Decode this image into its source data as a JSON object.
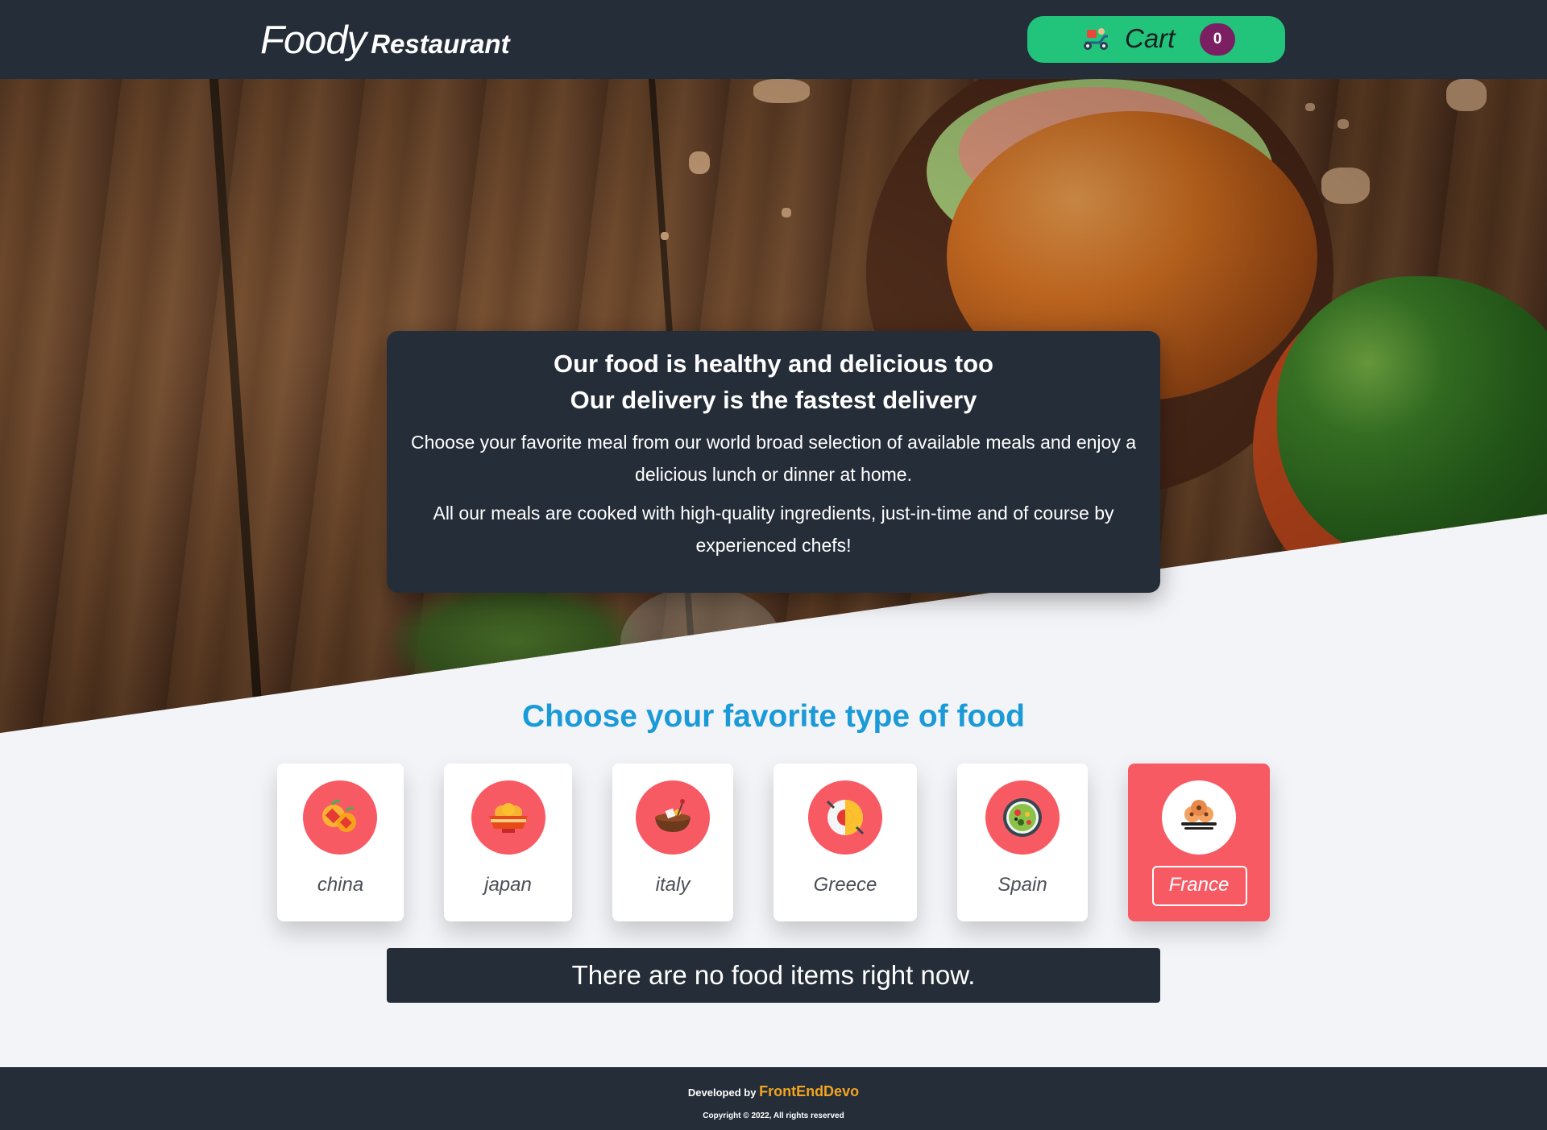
{
  "header": {
    "logo_main": "Foody",
    "logo_sub": "Restaurant",
    "cart_label": "Cart",
    "cart_count": "0",
    "cart_icon": "scooter-delivery-icon"
  },
  "hero": {
    "title_line1": "Our food is healthy and delicious too",
    "title_line2": "Our delivery is the fastest delivery",
    "paragraph1": "Choose your favorite meal from our world broad selection of available meals and enjoy a delicious lunch or dinner at home.",
    "paragraph2": "All our meals are cooked with high-quality ingredients, just-in-time and of course by experienced chefs!"
  },
  "section": {
    "title": "Choose your favorite type of food"
  },
  "food_types": [
    {
      "label": "china",
      "icon": "chinese-oranges-icon",
      "active": false
    },
    {
      "label": "japan",
      "icon": "japanese-bowl-icon",
      "active": false
    },
    {
      "label": "italy",
      "icon": "italian-pot-icon",
      "active": false
    },
    {
      "label": "Greece",
      "icon": "greek-pan-icon",
      "active": false
    },
    {
      "label": "Spain",
      "icon": "spanish-paella-icon",
      "active": false
    },
    {
      "label": "France",
      "icon": "french-pastry-icon",
      "active": true
    }
  ],
  "empty_message": "There are no food items right now.",
  "footer": {
    "developed_by": "Developed by",
    "developer": "FrontEndDevo",
    "copyright": "Copyright © 2022, All rights reserved"
  },
  "colors": {
    "header_bg": "#252d39",
    "cart_green": "#21c47a",
    "cart_badge": "#7c1e62",
    "accent_blue": "#1a9ad6",
    "active_red": "#f85a64",
    "footer_accent": "#f2a41f"
  }
}
